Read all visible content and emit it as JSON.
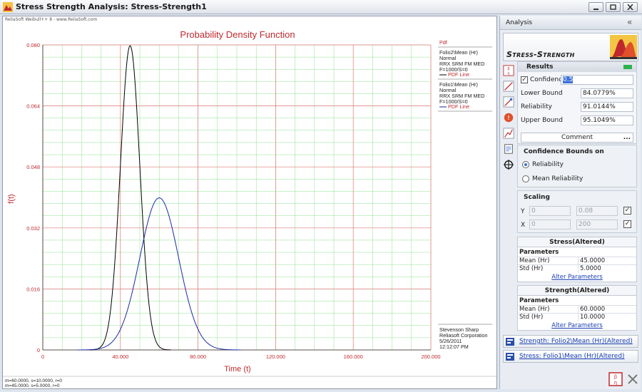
{
  "window": {
    "title": "Stress Strength Analysis: Stress-Strength1",
    "minimize_glyph": "_",
    "maximize_glyph": "□",
    "close_glyph": "×"
  },
  "chart_header": {
    "watermark": "ReliaSoft Weibull++ 8 - www.ReliaSoft.com"
  },
  "chart_data": {
    "type": "line",
    "title": "Probability Density Function",
    "xlabel": "Time (t)",
    "ylabel": "f(t)",
    "xlim": [
      0,
      200
    ],
    "ylim": [
      0,
      0.08
    ],
    "x_ticks": [
      0,
      40,
      80,
      120,
      160,
      200
    ],
    "x_tick_labels": [
      "0",
      "40.000",
      "80.000",
      "120.000",
      "160.000",
      "200.000"
    ],
    "y_ticks": [
      0,
      0.016,
      0.032,
      0.048,
      0.064,
      0.08
    ],
    "y_tick_labels": [
      "0",
      "0.016",
      "0.032",
      "0.048",
      "0.064",
      "0.080"
    ],
    "grid": true,
    "grid_color": "#8fe08f",
    "major_grid_color": "#e07a7a",
    "series": [
      {
        "distribution": "normal",
        "mean": 45,
        "std": 5,
        "color": "#000000"
      },
      {
        "distribution": "normal",
        "mean": 60,
        "std": 10,
        "color": "#1a2aa8"
      }
    ],
    "legend": {
      "header": "Pdf",
      "entries": [
        {
          "lines": [
            "Folio2\\Mean (Hr)",
            "Normal",
            "RRX SRM FM MED",
            "F=1000/S=0"
          ],
          "line_label": "PDF Line"
        },
        {
          "lines": [
            "Folio1\\Mean (Hr)",
            "Normal",
            "RRX SRM FM MED",
            "F=1000/S=0"
          ],
          "line_label": "PDF Line"
        }
      ]
    },
    "info_block": [
      "Stevenson Sharp",
      "Reliasoft Corporation",
      "5/26/2011",
      "12:12:07 PM"
    ],
    "footer": [
      "m=60.0000, s=10.0000, r=0",
      "m=45.0000, s=5.0000, r=0"
    ],
    "colors": {
      "title": "#c0282d",
      "axis_label": "#c0282d",
      "tick_label": "#c0282d"
    }
  },
  "panel": {
    "header": "Analysis",
    "collapse_glyph": "«",
    "logo_text": "Stress-Strength",
    "results": {
      "title": "Results",
      "confidence_label": "Confidence",
      "confidence_value": "0.5",
      "confidence_checked": true,
      "lower_bound_label": "Lower Bound",
      "lower_bound_value": "84.0779%",
      "reliability_label": "Reliability",
      "reliability_value": "91.0144%",
      "upper_bound_label": "Upper Bound",
      "upper_bound_value": "95.1049%",
      "comment_label": "Comment",
      "comment_dots": "..."
    },
    "bounds": {
      "title": "Confidence Bounds on",
      "options": [
        "Reliability",
        "Mean Reliability"
      ],
      "selected": 0
    },
    "scaling": {
      "title": "Scaling",
      "y_label": "Y",
      "y_min": "0",
      "y_max": "0.08",
      "x_label": "X",
      "x_min": "0",
      "x_max": "200",
      "check_glyph": "✓"
    },
    "stress": {
      "title": "Stress(Altered)",
      "params_label": "Parameters",
      "rows": [
        {
          "key": "Mean (Hr)",
          "value": "45.0000"
        },
        {
          "key": "Std (Hr)",
          "value": "5.0000"
        }
      ],
      "alter_label": "Alter Parameters"
    },
    "strength": {
      "title": "Strength(Altered)",
      "params_label": "Parameters",
      "rows": [
        {
          "key": "Mean (Hr)",
          "value": "60.0000"
        },
        {
          "key": "Std (Hr)",
          "value": "10.0000"
        }
      ],
      "alter_label": "Alter Parameters"
    },
    "links": [
      {
        "label": "Strength: Folio2\\Mean (Hr)(Altered)"
      },
      {
        "label": "Stress: Folio1\\Mean (Hr)(Altered)"
      }
    ],
    "toolbar_icons": [
      "calculate-icon",
      "plot-line-icon",
      "plot-edit-icon",
      "warning-icon",
      "chart-tool-icon",
      "report-icon",
      "target-icon"
    ]
  }
}
